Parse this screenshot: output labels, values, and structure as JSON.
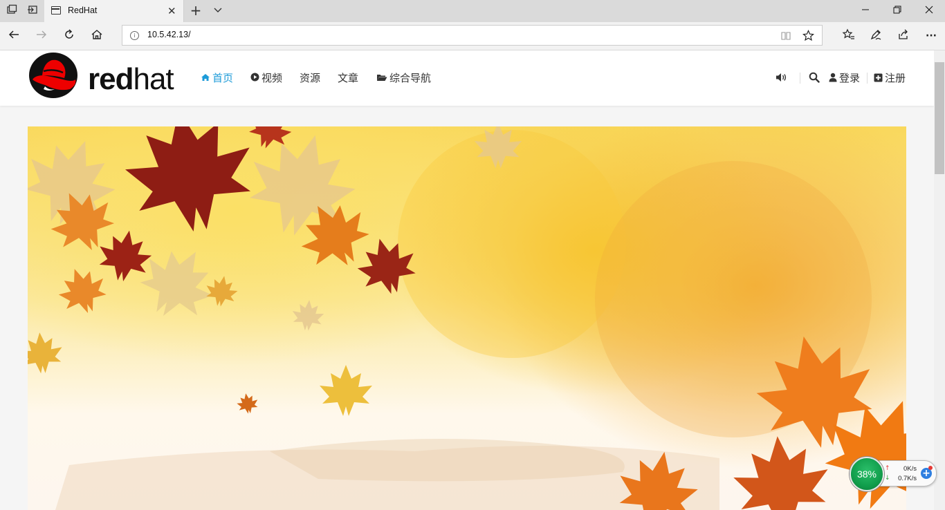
{
  "browser": {
    "tab": {
      "title": "RedHat",
      "close_glyph": "✕",
      "icon": "page-icon"
    },
    "new_tab_glyph": "+",
    "tab_list_glyph": "⌄",
    "window_controls": {
      "minimize": "—",
      "maximize": "❐",
      "close": "✕"
    },
    "address": {
      "url": "10.5.42.13/"
    },
    "nav_glyphs": {
      "back": "←",
      "forward": "→",
      "refresh": "↻",
      "home": "⌂"
    },
    "toolbar_glyphs": {
      "reading_view": "▯",
      "favorite": "☆",
      "favorites_hub": "☆",
      "notes": "✎",
      "share": "⇪",
      "more": "···"
    }
  },
  "site": {
    "logo": {
      "bold": "red",
      "light": "hat"
    },
    "menu": [
      {
        "label": "首页",
        "icon": "home-icon",
        "glyph": "⌂",
        "active": true
      },
      {
        "label": "视频",
        "icon": "play-circle-icon",
        "glyph": "▶",
        "active": false
      },
      {
        "label": "资源",
        "icon": "",
        "glyph": "",
        "active": false
      },
      {
        "label": "文章",
        "icon": "",
        "glyph": "",
        "active": false
      },
      {
        "label": "综合导航",
        "icon": "folder-open-icon",
        "glyph": "▰",
        "active": false
      }
    ],
    "header_right": {
      "volume_glyph": "🔈",
      "search_glyph": "⌕",
      "login": {
        "label": "登录",
        "icon": "user-icon",
        "glyph": "👤"
      },
      "register": {
        "label": "注册",
        "icon": "plus-square-icon",
        "glyph": "⊞"
      }
    },
    "accent_color": "#1d9bd8"
  },
  "widget": {
    "cpu_percent": "38%",
    "upload": "0K/s",
    "download": "0.7K/s",
    "up_glyph": "↑",
    "down_glyph": "↓",
    "plus_glyph": "+"
  }
}
